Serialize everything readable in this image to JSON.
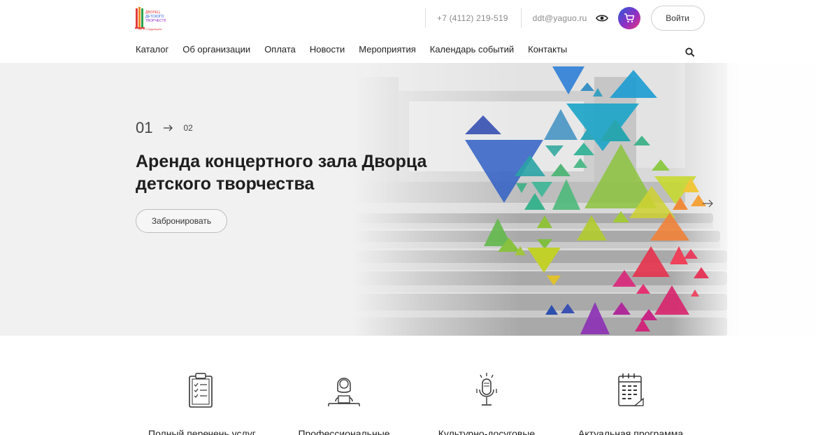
{
  "header": {
    "logo_text": "ДВОРЕЦ ДЕТСКОГО ТВОРЧЕСТВА",
    "phone": "+7 (4112) 219-519",
    "email": "ddt@yaguo.ru",
    "eye_icon": "eye-icon",
    "cart_icon": "cart-icon",
    "login_label": "Войти"
  },
  "nav": {
    "items": [
      "Каталог",
      "Об организации",
      "Оплата",
      "Новости",
      "Мероприятия",
      "Календарь событий",
      "Контакты"
    ],
    "search_icon": "search-icon"
  },
  "hero": {
    "current_slide": "01",
    "next_slide": "02",
    "title": "Аренда концертного зала Дворца детского творчества",
    "button_label": "Забронировать"
  },
  "features": {
    "items": [
      {
        "icon": "checklist-icon",
        "label": "Полный перечень услуг"
      },
      {
        "icon": "teacher-icon",
        "label": "Профессиональные"
      },
      {
        "icon": "microphone-icon",
        "label": "Культурно-досуговые"
      },
      {
        "icon": "calendar-icon",
        "label": "Актуальная программа"
      }
    ]
  },
  "colors": {
    "accent_gradient": [
      "#2a5bd7",
      "#8e2fc6",
      "#e8337a"
    ],
    "text": "#222222",
    "muted": "#8a8a8a"
  }
}
